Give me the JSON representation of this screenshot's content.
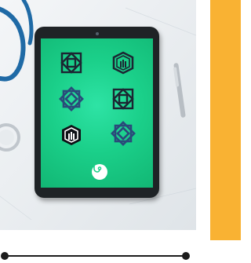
{
  "colors": {
    "accent_panel": "#f9b233",
    "screen": "#1bd08a",
    "icon_dark": "#1c2532",
    "icon_blue": "#2a4a7a"
  },
  "apps": [
    {
      "icon": "geometric-star-grid-icon"
    },
    {
      "icon": "building-shield-icon"
    },
    {
      "icon": "octagram-lattice-icon"
    },
    {
      "icon": "geometric-star-grid-icon"
    },
    {
      "icon": "building-shield-icon"
    },
    {
      "icon": "octagram-lattice-icon"
    }
  ],
  "dock": {
    "icon": "stethoscope-icon"
  }
}
